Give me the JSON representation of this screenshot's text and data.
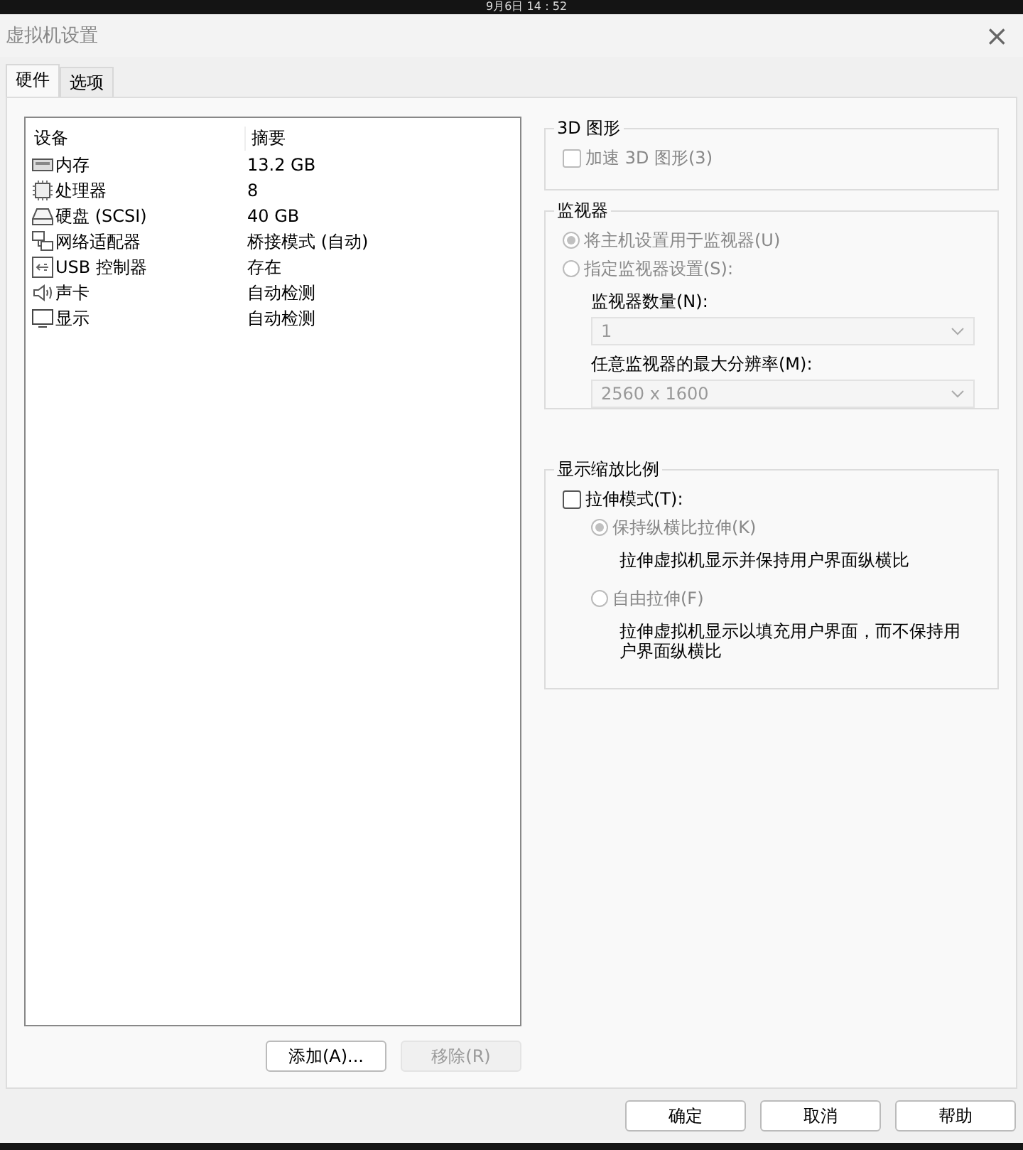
{
  "top_bar": {
    "clock": "9月6日  14：52"
  },
  "window": {
    "title": "虚拟机设置",
    "close": "×"
  },
  "tabs": [
    {
      "label": "硬件",
      "selected": true
    },
    {
      "label": "选项",
      "selected": false
    }
  ],
  "device_list": {
    "columns": [
      "设备",
      "摘要"
    ],
    "rows": [
      {
        "kind": "memory",
        "device": "内存",
        "summary": "13.2 GB",
        "selected": false
      },
      {
        "kind": "cpu",
        "device": "处理器",
        "summary": "8",
        "selected": false
      },
      {
        "kind": "disk",
        "device": "硬盘 (SCSI)",
        "summary": "40 GB",
        "selected": false
      },
      {
        "kind": "network",
        "device": "网络适配器",
        "summary": "桥接模式 (自动)",
        "selected": false
      },
      {
        "kind": "usb",
        "device": "USB 控制器",
        "summary": "存在",
        "selected": false
      },
      {
        "kind": "sound",
        "device": "声卡",
        "summary": "自动检测",
        "selected": false
      },
      {
        "kind": "display",
        "device": "显示",
        "summary": "自动检测",
        "selected": false
      }
    ]
  },
  "list_buttons": [
    {
      "label": "添加(A)...",
      "disabled": false
    },
    {
      "label": "移除(R)",
      "disabled": true
    }
  ],
  "graphics_3d": {
    "title": "3D 图形",
    "accelerate": {
      "label": "加速 3D 图形(3)",
      "checked": false,
      "disabled": true
    }
  },
  "monitors": {
    "title": "监视器",
    "options": [
      {
        "label": "将主机设置用于监视器(U)",
        "selected": true,
        "disabled": true
      },
      {
        "label": "指定监视器设置(S):",
        "selected": false,
        "disabled": true
      }
    ],
    "count": {
      "label": "监视器数量(N):",
      "value": "1",
      "disabled": true
    },
    "resolution": {
      "label": "任意监视器的最大分辨率(M):",
      "value": "2560 x 1600",
      "disabled": true
    }
  },
  "display_scaling": {
    "title": "显示缩放比例",
    "stretch": {
      "label": "拉伸模式(T):",
      "checked": false,
      "disabled": false
    },
    "options": [
      {
        "label": "保持纵横比拉伸(K)",
        "selected": true,
        "disabled": true,
        "description": "拉伸虚拟机显示并保持用户界面纵横比"
      },
      {
        "label": "自由拉伸(F)",
        "selected": false,
        "disabled": true,
        "description": "拉伸虚拟机显示以填充用户界面，而不保持用户界面纵横比"
      }
    ]
  },
  "dialog_buttons": [
    "确定",
    "取消",
    "帮助"
  ]
}
